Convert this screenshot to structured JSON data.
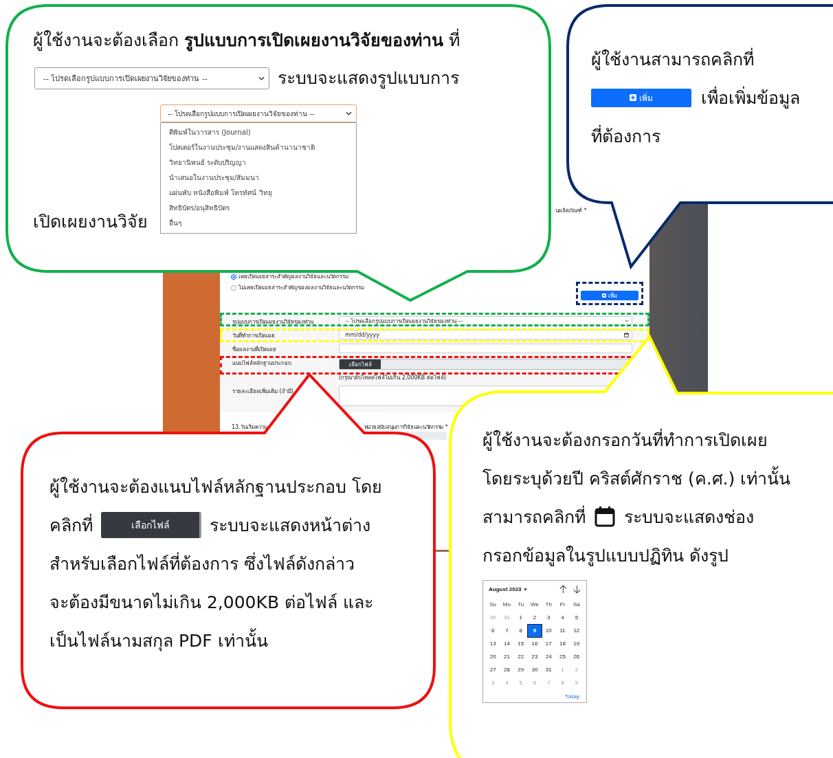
{
  "screen": {
    "side_note": "นผลิตภัณฑ์ *",
    "radios": [
      {
        "label": "เคยเปิดเผยสาระสำคัญผลงานวิจัยและนวัตกรรม",
        "selected": true
      },
      {
        "label": "ไม่เคยเปิดเผยสาระสำคัญของผลงานวิจัยและนวัตกรรม",
        "selected": false
      }
    ],
    "add_button": "เพิ่ม",
    "form": [
      {
        "kind": "select",
        "label": "รูปแบบการเปิดเผยงานวิจัยของท่าน",
        "value": "-- โปรดเลือกรูปแบบการเปิดเผยงานวิจัยของท่าน --"
      },
      {
        "kind": "date",
        "label": "วันที่ทำการเปิดเผย",
        "value": "mm/dd/yyyy"
      },
      {
        "kind": "text",
        "label": "ชื่อผลงานที่เปิดเผย"
      },
      {
        "kind": "file",
        "label": "แนบไฟล์หลักฐานประกอบ",
        "button": "เลือกไฟล์",
        "hint": "(กรุณาอัปโหลดไฟล์ไม่เกิน 2,000KB ต่อไฟล์)"
      },
      {
        "kind": "textarea",
        "label": "รายละเอียดเพิ่มเติม (ถ้ามี)"
      }
    ],
    "next_section": "13.วันเริ่มความ",
    "next_field": "หน่วยสนับสนุนการวิจัยและนวัตกรรม *"
  },
  "callouts": [
    {
      "kind": "select-help",
      "lines": [
        [
          {
            "kind": "text",
            "text": "ผู้ใช้งานจะต้องเลือก **รูปแบบการเปิดเผยงานวิจัยของท่าน** ที่"
          }
        ]
      ],
      "select": "-- โปรดเลือกรูปแบบการเปิดเผยงานวิจัยของท่าน --",
      "after_select": "ระบบจะแสดงรูปแบบการ",
      "bottom_text": "เปิดเผยงานวิจัย",
      "dropdown": {
        "value": "-- โปรดเลือกรูปแบบการเปิดเผยงานวิจัยของท่าน --",
        "options": [
          "ตีพิมพ์ในวารสาร (Journal)",
          "โปสเตอร์ในงานประชุม/งานแสดงสินค้านานาชาติ",
          "วิทยานิพนธ์ ระดับปริญญา",
          "นำเสนอในงานประชุม/สัมมนา",
          "แผ่นพับ หนังสือพิมพ์ โทรทัศน์ วิทยุ",
          "สิทธิบัตร/อนุสิทธิบัตร",
          "อื่นๆ"
        ]
      }
    },
    {
      "kind": "add-help",
      "lines": [
        [
          {
            "kind": "text",
            "text": "ผู้ใช้งานสามารถคลิกที่"
          }
        ],
        [
          {
            "kind": "add-button",
            "text": "เพิ่ม"
          },
          {
            "kind": "text",
            "text": "เพื่อเพิ่มข้อมูล"
          }
        ],
        [
          {
            "kind": "text",
            "text": "ที่ต้องการ"
          }
        ]
      ]
    },
    {
      "kind": "file-help",
      "lines": [
        [
          {
            "kind": "text",
            "text": "ผู้ใช้งานจะต้องแนบไฟล์หลักฐานประกอบ โดย"
          }
        ],
        [
          {
            "kind": "text",
            "text": "คลิกที่"
          },
          {
            "kind": "file-button",
            "text": "เลือกไฟล์"
          },
          {
            "kind": "text",
            "text": "ระบบจะแสดงหน้าต่าง"
          }
        ],
        [
          {
            "kind": "text",
            "text": "สำหรับเลือกไฟล์ที่ต้องการ ซึ่งไฟล์ดังกล่าว"
          }
        ],
        [
          {
            "kind": "text",
            "text": "จะต้องมีขนาดไม่เกิน 2,000KB ต่อไฟล์ และ"
          }
        ],
        [
          {
            "kind": "text",
            "text": "เป็นไฟล์นามสกุล PDF เท่านั้น"
          }
        ]
      ]
    },
    {
      "kind": "date-help",
      "lines": [
        [
          {
            "kind": "text",
            "text": "ผู้ใช้งานจะต้องกรอกวันที่ทำการเปิดเผย"
          }
        ],
        [
          {
            "kind": "text",
            "text": "โดยระบุด้วยปี คริสต์ศักราช (ค.ศ.) เท่านั้น"
          }
        ],
        [
          {
            "kind": "text",
            "text": "สามารถคลิกที่"
          },
          {
            "kind": "calendar-icon"
          },
          {
            "kind": "text",
            "text": "ระบบจะแสดงช่อง"
          }
        ],
        [
          {
            "kind": "text",
            "text": "กรอกข้อมูลในรูปแบบปฏิทิน ดังรูป"
          }
        ]
      ],
      "calendar": {
        "month": "August 2023",
        "weekdays": [
          "Su",
          "Mo",
          "Tu",
          "We",
          "Th",
          "Fr",
          "Sa"
        ],
        "weeks": [
          [
            {
              "day": "30",
              "muted": true,
              "selected": false
            },
            {
              "day": "31",
              "muted": true,
              "selected": false
            },
            {
              "day": "1",
              "muted": false,
              "selected": false
            },
            {
              "day": "2",
              "muted": false,
              "selected": false
            },
            {
              "day": "3",
              "muted": false,
              "selected": false
            },
            {
              "day": "4",
              "muted": false,
              "selected": false
            },
            {
              "day": "5",
              "muted": false,
              "selected": false
            }
          ],
          [
            {
              "day": "6",
              "muted": false,
              "selected": false
            },
            {
              "day": "7",
              "muted": false,
              "selected": false
            },
            {
              "day": "8",
              "muted": false,
              "selected": false
            },
            {
              "day": "9",
              "muted": false,
              "selected": true
            },
            {
              "day": "10",
              "muted": false,
              "selected": false
            },
            {
              "day": "11",
              "muted": false,
              "selected": false
            },
            {
              "day": "12",
              "muted": false,
              "selected": false
            }
          ],
          [
            {
              "day": "13",
              "muted": false,
              "selected": false
            },
            {
              "day": "14",
              "muted": false,
              "selected": false
            },
            {
              "day": "15",
              "muted": false,
              "selected": false
            },
            {
              "day": "16",
              "muted": false,
              "selected": false
            },
            {
              "day": "17",
              "muted": false,
              "selected": false
            },
            {
              "day": "18",
              "muted": false,
              "selected": false
            },
            {
              "day": "19",
              "muted": false,
              "selected": false
            }
          ],
          [
            {
              "day": "20",
              "muted": false,
              "selected": false
            },
            {
              "day": "21",
              "muted": false,
              "selected": false
            },
            {
              "day": "22",
              "muted": false,
              "selected": false
            },
            {
              "day": "23",
              "muted": false,
              "selected": false
            },
            {
              "day": "24",
              "muted": false,
              "selected": false
            },
            {
              "day": "25",
              "muted": false,
              "selected": false
            },
            {
              "day": "26",
              "muted": false,
              "selected": false
            }
          ],
          [
            {
              "day": "27",
              "muted": false,
              "selected": false
            },
            {
              "day": "28",
              "muted": false,
              "selected": false
            },
            {
              "day": "29",
              "muted": false,
              "selected": false
            },
            {
              "day": "30",
              "muted": false,
              "selected": false
            },
            {
              "day": "31",
              "muted": false,
              "selected": false
            },
            {
              "day": "1",
              "muted": true,
              "selected": false
            },
            {
              "day": "2",
              "muted": true,
              "selected": false
            }
          ],
          [
            {
              "day": "3",
              "muted": true,
              "selected": false
            },
            {
              "day": "4",
              "muted": true,
              "selected": false
            },
            {
              "day": "5",
              "muted": true,
              "selected": false
            },
            {
              "day": "6",
              "muted": true,
              "selected": false
            },
            {
              "day": "7",
              "muted": true,
              "selected": false
            },
            {
              "day": "8",
              "muted": true,
              "selected": false
            },
            {
              "day": "9",
              "muted": true,
              "selected": false
            }
          ]
        ],
        "today": "Today"
      }
    }
  ]
}
